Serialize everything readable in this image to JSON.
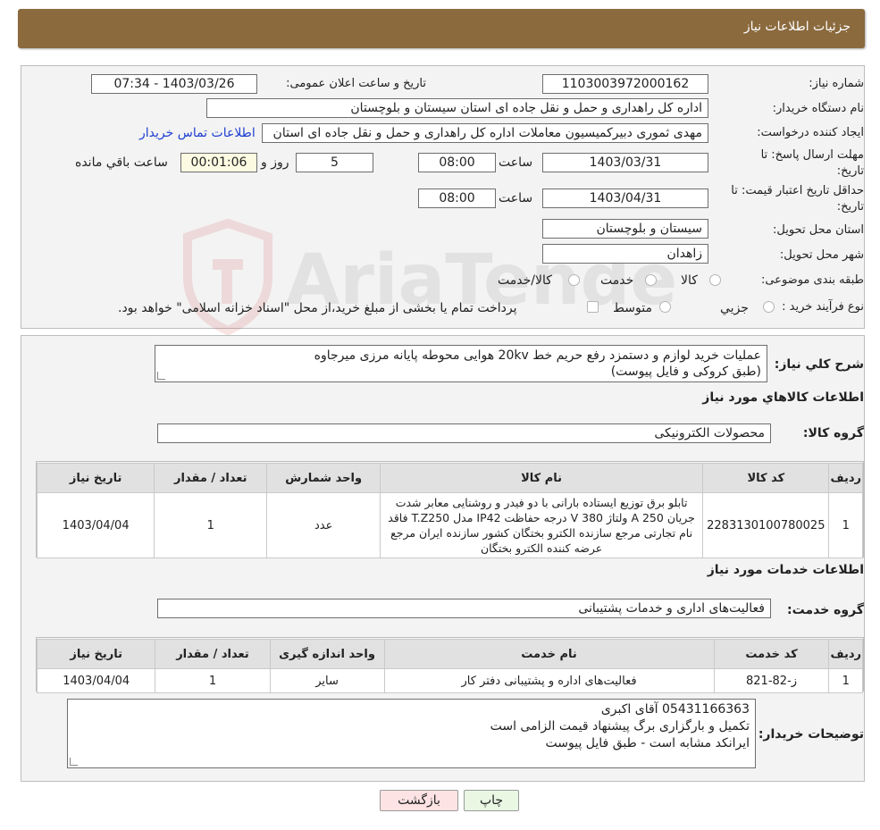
{
  "header": {
    "title": "جزئیات اطلاعات نیاز"
  },
  "form": {
    "need_number_label": "شماره نیاز:",
    "need_number": "1103003972000162",
    "announce_label": "تاریخ و ساعت اعلان عمومی:",
    "announce_value": "1403/03/26 - 07:34",
    "buyer_org_label": "نام دستگاه خریدار:",
    "buyer_org": "اداره کل راهداری و حمل و نقل جاده ای استان سیستان و بلوچستان",
    "creator_label": "ایجاد کننده درخواست:",
    "creator": "مهدی ثموری دبیرکمیسیون معاملات اداره کل راهداری و حمل و نقل جاده ای استان",
    "contact_link": "اطلاعات تماس خریدار",
    "deadline_label_1": "مهلت ارسال پاسخ: تا",
    "deadline_label_2": "تاریخ:",
    "deadline_date": "1403/03/31",
    "time_label": "ساعت",
    "deadline_time": "08:00",
    "days_value": "5",
    "days_label": "روز و",
    "remaining_value": "00:01:06",
    "remaining_label": "ساعت باقي مانده",
    "validity_label_1": "حداقل تاریخ اعتبار قیمت: تا",
    "validity_label_2": "تاریخ:",
    "validity_date": "1403/04/31",
    "validity_time": "08:00",
    "province_label": "استان محل تحویل:",
    "province": "سیستان و بلوچستان",
    "city_label": "شهر محل تحویل:",
    "city": "زاهدان",
    "category_label": "طبقه بندی موضوعی:",
    "category_options": [
      "کالا",
      "خدمت",
      "کالا/خدمت"
    ],
    "process_label": "نوع فرآیند خرید :",
    "process_options": [
      "جزيي",
      "متوسط"
    ],
    "process_note": "پرداخت تمام یا بخشی از مبلغ خرید،از محل \"اسناد خزانه اسلامی\" خواهد بود."
  },
  "description": {
    "label": "شرح كلي نياز:",
    "line1": "عملیات خرید لوازم و دستمزد رفع حریم خط 20kv هوایی محوطه پایانه مرزی میرجاوه",
    "line2": "(طبق  کروکی و فایل پیوست)"
  },
  "goods": {
    "section_title": "اطلاعات كالاهاي مورد نياز",
    "group_label": "گروه كالا:",
    "group_value": "محصولات الکترونیکی",
    "columns": [
      "ردیف",
      "کد کالا",
      "نام کالا",
      "واحد شمارش",
      "تعداد / مقدار",
      "تاریخ نیاز"
    ],
    "rows": [
      {
        "row": "1",
        "code": "2283130100780025",
        "name": "تابلو برق توزیع ایستاده بارانی با دو فیدر و روشنایی معابر شدت جریان 250 A ولتاژ 380 V درجه حفاظت IP42 مدل T.Z250 فاقد نام تجارتی مرجع سازنده الکترو بختگان کشور سازنده ایران مرجع عرضه کننده الکترو بختگان",
        "unit": "عدد",
        "qty": "1",
        "date": "1403/04/04"
      }
    ]
  },
  "services": {
    "section_title": "اطلاعات خدمات مورد نياز",
    "group_label": "گروه خدمت:",
    "group_value": "فعالیت‌های اداری و خدمات پشتیبانی",
    "columns": [
      "ردیف",
      "کد خدمت",
      "نام خدمت",
      "واحد اندازه گیری",
      "تعداد / مقدار",
      "تاریخ نیاز"
    ],
    "rows": [
      {
        "row": "1",
        "code": "ز-82-821",
        "name": "فعالیت‌های اداره و پشتیبانی دفتر کار",
        "unit": "سایر",
        "qty": "1",
        "date": "1403/04/04"
      }
    ]
  },
  "buyer_notes": {
    "label": "توضیحات خریدار:",
    "line1": "05431166363 آقای اکبری",
    "line2": "تکمیل و بارگزاری برگ پیشنهاد قیمت الزامی است",
    "line3": "ایرانکد مشابه است - طبق فایل پیوست"
  },
  "buttons": {
    "print": "چاپ",
    "back": "بازگشت"
  },
  "colors": {
    "header": "#8b6a3e",
    "link": "#1d3fd1",
    "back_button": "#fde3e3",
    "print_button": "#e9f7e3"
  },
  "watermark": {
    "text": "AriaTender.neT"
  }
}
